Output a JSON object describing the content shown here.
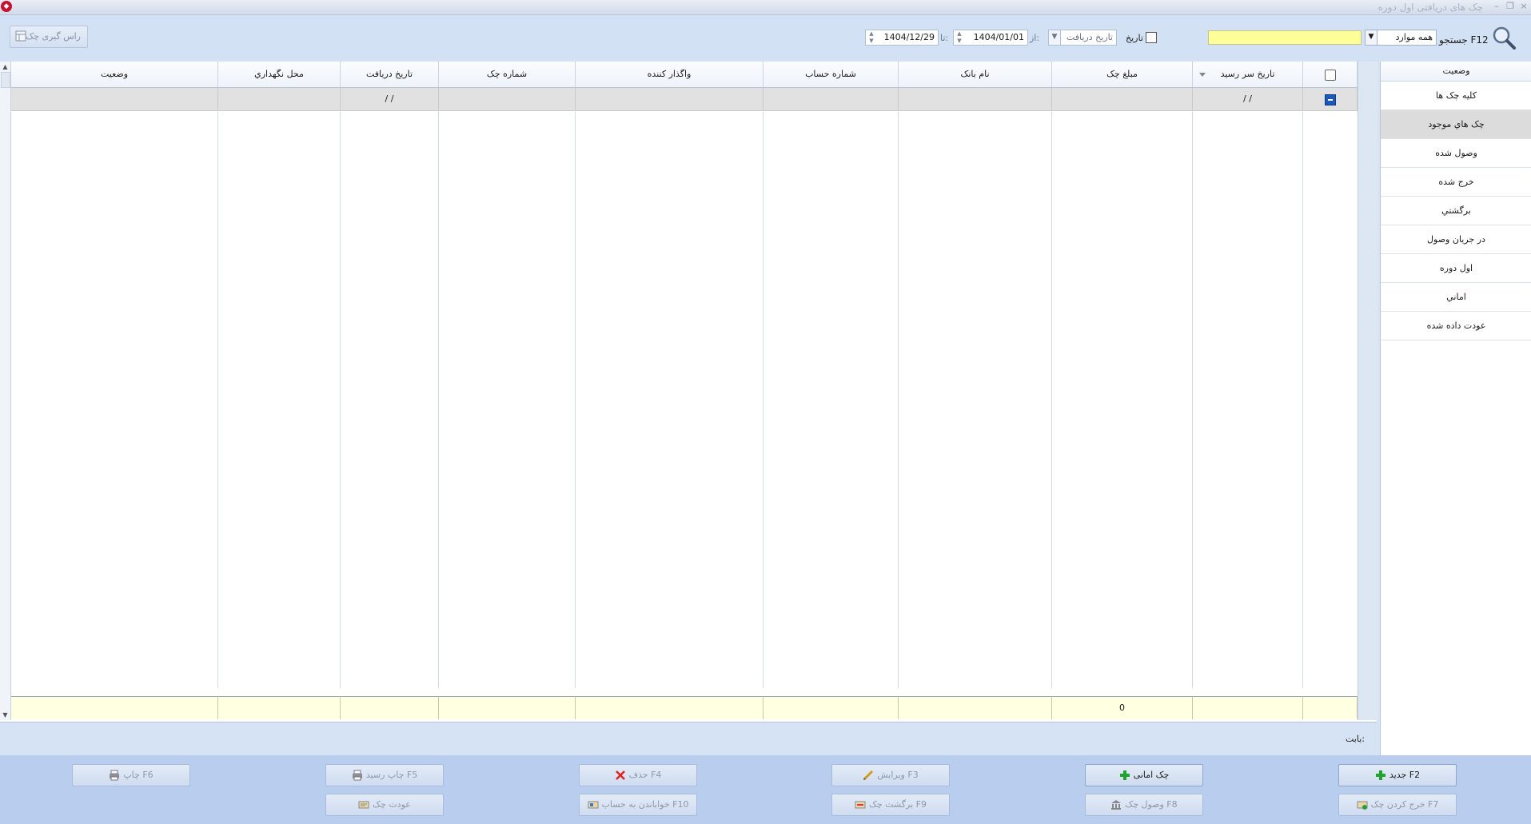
{
  "window": {
    "title": "چک های دریافتی اول دوره"
  },
  "toolbar": {
    "search_label": "جستجو F12",
    "scope_value": "همه موارد",
    "search_value": "",
    "date_checkbox_label": "تاریخ",
    "date_field_value": "تاریخ دریافت",
    "from_label": "از:",
    "from_date": "1404/01/01",
    "to_label": "تا:",
    "to_date": "1404/12/29",
    "balance_button": "راس گیری چک"
  },
  "grid": {
    "columns": [
      "",
      "تاریخ سر رسید",
      "مبلغ چک",
      "نام بانک",
      "شماره حساب",
      "واگذار کننده",
      "شماره چک",
      "تاریخ دریافت",
      "محل نگهداري",
      "وضعیت"
    ],
    "filter_row": {
      "due_date": "/ /",
      "received_date": "/ /"
    },
    "footer": {
      "amount_total": "0"
    }
  },
  "status_panel": {
    "title": "وضعیت",
    "items": [
      "کلیه چک ها",
      "چک هاي موجود",
      "وصول شده",
      "خرج شده",
      "برگشتي",
      "در جريان وصول",
      "اول دوره",
      "اماني",
      "عودت داده شده"
    ],
    "selected_index": 1
  },
  "description": {
    "label": "بابت:"
  },
  "actions": {
    "new": "جدید F2",
    "trust": "چک امانی",
    "edit": "ویرایش F3",
    "delete": "حذف F4",
    "print_receipt": "چاپ رسید F5",
    "print": "چاپ F6",
    "spend": "خرج کردن چک F7",
    "collect": "وصول چک F8",
    "bounce": "برگشت چک F9",
    "deposit": "خواباندن به حساب F10",
    "return": "عودت چک"
  },
  "colors": {
    "search_bg": "#ffff99",
    "footer_bg": "#ffffe1",
    "selected_side": "#dcdcdc",
    "actions_bg": "#b9cdee"
  }
}
